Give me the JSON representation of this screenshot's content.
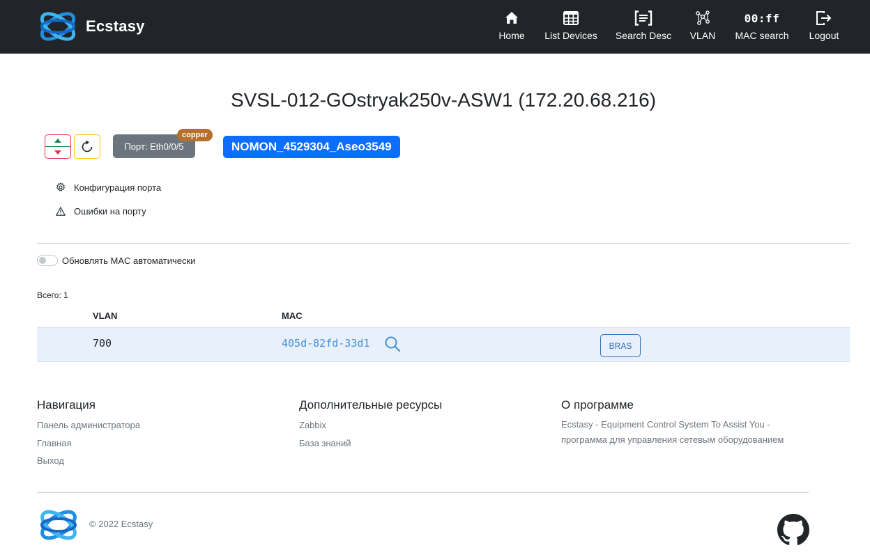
{
  "brand": {
    "name": "Ecstasy"
  },
  "nav": [
    {
      "label": "Home",
      "icon": "home-icon"
    },
    {
      "label": "List Devices",
      "icon": "table-icon"
    },
    {
      "label": "Search Desc",
      "icon": "search-text-icon"
    },
    {
      "label": "VLAN",
      "icon": "network-graph-icon"
    },
    {
      "label": "MAC search",
      "icon": "mac-glyph",
      "glyph": "00:ff"
    },
    {
      "label": "Logout",
      "icon": "logout-icon"
    }
  ],
  "device": {
    "title": "SVSL-012-GOstryak250v-ASW1 (172.20.68.216)"
  },
  "port": {
    "label": "Порт: Eth0/0/5",
    "media": "copper",
    "description": "NOMON_4529304_Aseo3549"
  },
  "actions": {
    "config": "Конфигурация порта",
    "errors": "Ошибки на порту"
  },
  "auto_refresh": {
    "label": "Обновлять MAC автоматически",
    "enabled": false
  },
  "table": {
    "total": "Всего: 1",
    "headers": {
      "vlan": "VLAN",
      "mac": "MAC"
    },
    "rows": [
      {
        "vlan": "700",
        "mac": "405d-82fd-33d1",
        "action": "BRAS"
      }
    ]
  },
  "footer": {
    "nav_title": "Навигация",
    "nav_links": [
      "Панель администратора",
      "Главная",
      "Выход"
    ],
    "res_title": "Дополнительные ресурсы",
    "res_links": [
      "Zabbix",
      "База знаний"
    ],
    "about_title": "О программе",
    "about_lines": [
      "Ecstasy - Equipment Control System To Assist You -",
      "программа для управления сетевым оборудованием"
    ],
    "copyright": "© 2022 Ecstasy"
  },
  "colors": {
    "navbar": "#212529",
    "primary": "#0d6efd",
    "secondary": "#6c757d",
    "copper": "#b5712c",
    "row_highlight": "#e7f0fb"
  }
}
